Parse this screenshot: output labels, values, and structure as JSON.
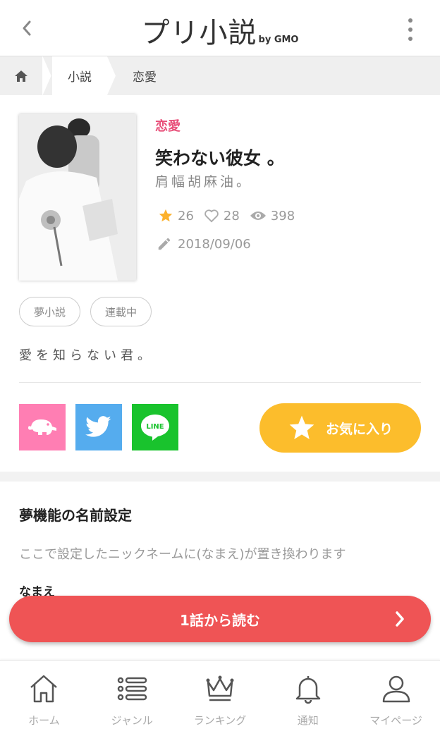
{
  "header": {
    "logo_main": "プリ小説",
    "logo_sub": "by GMO"
  },
  "breadcrumb": {
    "items": [
      {
        "label": "小説"
      },
      {
        "label": "恋愛"
      }
    ]
  },
  "book": {
    "genre": "恋愛",
    "title": "笑わない彼女 。",
    "author": "肩幅胡麻油。",
    "stars": "26",
    "likes": "28",
    "views": "398",
    "date": "2018/09/06",
    "tags": [
      "夢小説",
      "連載中"
    ],
    "description": "愛を知らない君。",
    "favorite_label": "お気に入り"
  },
  "share": {
    "line_label": "LINE"
  },
  "name_settings": {
    "title": "夢機能の名前設定",
    "description": "ここで設定したニックネームに(なまえ)が置き換わります",
    "name_label": "なまえ"
  },
  "read_button": {
    "label": "1話から読む"
  },
  "bottom_nav": {
    "items": [
      {
        "label": "ホーム"
      },
      {
        "label": "ジャンル"
      },
      {
        "label": "ランキング"
      },
      {
        "label": "通知"
      },
      {
        "label": "マイページ"
      }
    ]
  },
  "colors": {
    "accent_red": "#ef5455",
    "genre_pink": "#e8507a",
    "favorite_yellow": "#fcbd2c",
    "elephant_pink": "#ff7eb3",
    "twitter_blue": "#55acee",
    "line_green": "#19c32d"
  }
}
